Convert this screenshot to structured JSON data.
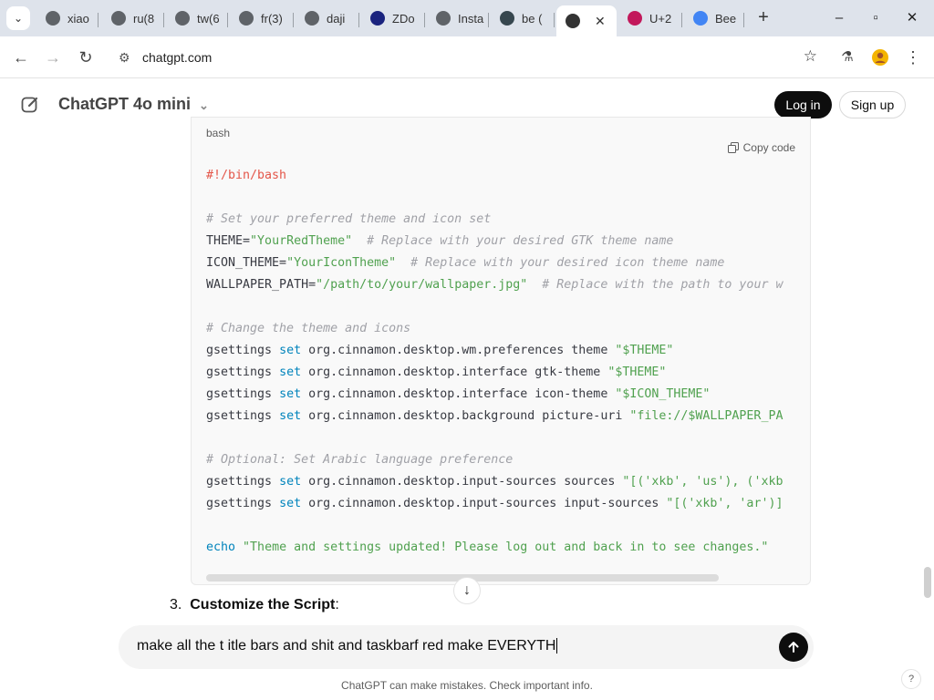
{
  "browser": {
    "tabs": [
      {
        "label": "xiao",
        "icon": "globe-icon",
        "color": "#5f6368"
      },
      {
        "label": "ru(8",
        "icon": "globe-icon",
        "color": "#5f6368"
      },
      {
        "label": "tw(6",
        "icon": "globe-icon",
        "color": "#5f6368"
      },
      {
        "label": "fr(3)",
        "icon": "globe-icon",
        "color": "#5f6368"
      },
      {
        "label": "daji",
        "icon": "globe-icon",
        "color": "#5f6368"
      },
      {
        "label": "ZDo",
        "icon": "zd-icon",
        "color": "#1a237e"
      },
      {
        "label": "Insta",
        "icon": "grid-icon",
        "color": "#5f6368"
      },
      {
        "label": "be (",
        "icon": "terminal-icon",
        "color": "#37474f"
      },
      {
        "label": "",
        "icon": "chatgpt-icon",
        "color": "#333333"
      },
      {
        "label": "U+2",
        "icon": "table-icon",
        "color": "#c2185b"
      },
      {
        "label": "Bee",
        "icon": "google-icon",
        "color": "#4285f4"
      }
    ],
    "active_tab_index": 8,
    "url": "chatgpt.com"
  },
  "header": {
    "model_title": "ChatGPT 4o mini",
    "login_label": "Log in",
    "signup_label": "Sign up"
  },
  "code_block": {
    "language": "bash",
    "copy_label": "Copy code",
    "lines": [
      "#!/bin/bash",
      "",
      "# Set your preferred theme and icon set",
      "THEME=\"YourRedTheme\"  # Replace with your desired GTK theme name",
      "ICON_THEME=\"YourIconTheme\"  # Replace with your desired icon theme name",
      "WALLPAPER_PATH=\"/path/to/your/wallpaper.jpg\"  # Replace with the path to your w",
      "",
      "# Change the theme and icons",
      "gsettings set org.cinnamon.desktop.wm.preferences theme \"$THEME\"",
      "gsettings set org.cinnamon.desktop.interface gtk-theme \"$THEME\"",
      "gsettings set org.cinnamon.desktop.interface icon-theme \"$ICON_THEME\"",
      "gsettings set org.cinnamon.desktop.background picture-uri \"file://$WALLPAPER_PA",
      "",
      "# Optional: Set Arabic language preference",
      "gsettings set org.cinnamon.desktop.input-sources sources \"[('xkb', 'us'), ('xkb",
      "gsettings set org.cinnamon.desktop.input-sources input-sources \"[('xkb', 'ar')]",
      "",
      "echo \"Theme and settings updated! Please log out and back in to see changes.\""
    ]
  },
  "step": {
    "number": "3.",
    "title": "Customize the Script",
    "suffix": ":"
  },
  "composer": {
    "text": "make all the t itle bars and shit and taskbarf red make EVERYTH"
  },
  "footer": {
    "disclaimer": "ChatGPT can make mistakes. Check important info.",
    "help": "?"
  }
}
